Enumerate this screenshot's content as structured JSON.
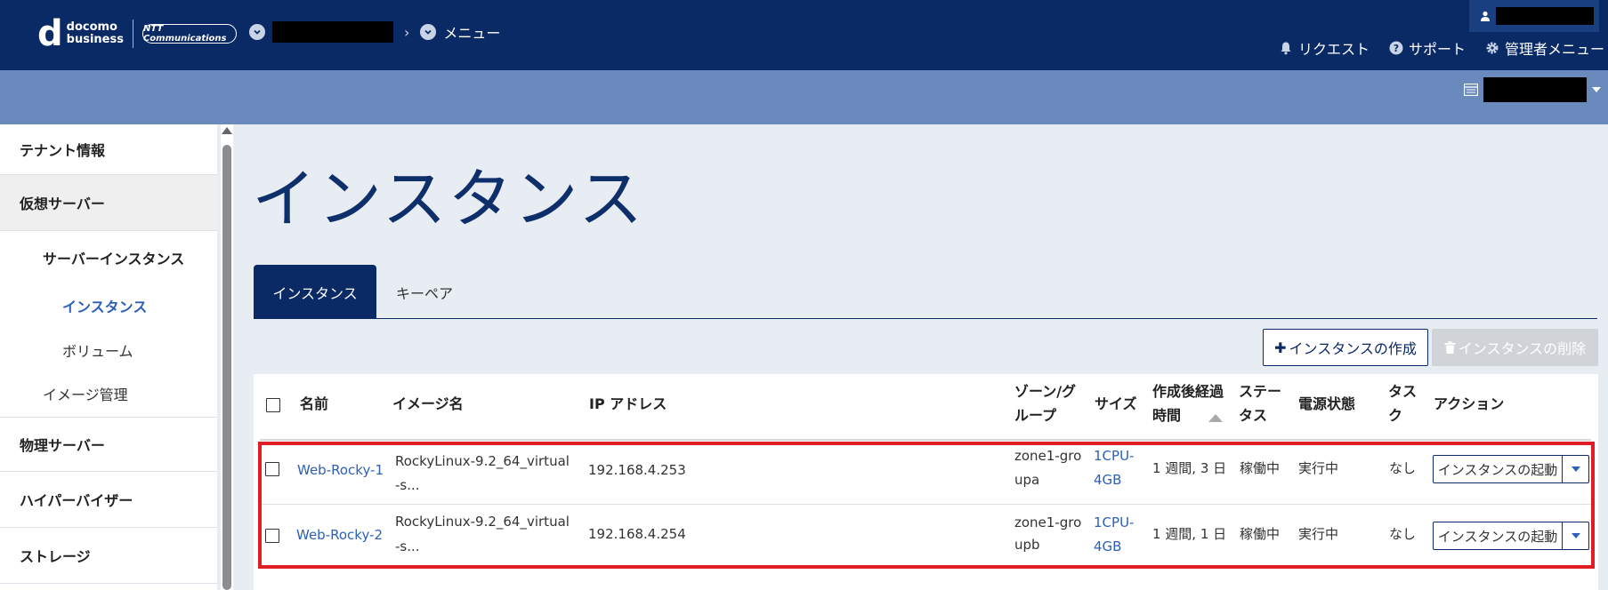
{
  "header": {
    "logo_line1": "docomo",
    "logo_line2": "business",
    "ntt_logo": "NTT Communications",
    "breadcrumb_menu": "メニュー",
    "links": [
      {
        "icon": "bell-icon",
        "label": "リクエスト"
      },
      {
        "icon": "question-icon",
        "label": "サポート"
      },
      {
        "icon": "gear-icon",
        "label": "管理者メニュー"
      }
    ]
  },
  "sidebar": {
    "items": [
      {
        "label": "テナント情報"
      },
      {
        "label": "仮想サーバー"
      },
      {
        "label": "物理サーバー"
      },
      {
        "label": "ハイパーバイザー"
      },
      {
        "label": "ストレージ"
      }
    ],
    "sub": {
      "server_instance": "サーバーインスタンス",
      "instance": "インスタンス",
      "volume": "ボリューム",
      "image_mgmt": "イメージ管理"
    }
  },
  "main": {
    "title": "インスタンス",
    "tabs": [
      {
        "label": "インスタンス"
      },
      {
        "label": "キーペア"
      }
    ],
    "create_button": "インスタンスの作成",
    "delete_button": "インスタンスの削除",
    "columns": {
      "name": "名前",
      "image": "イメージ名",
      "ip": "IP アドレス",
      "zone_1": "ゾーン/グ",
      "zone_2": "ループ",
      "size": "サイズ",
      "age_1": "作成後経過",
      "age_2": "時間",
      "status_1": "ステー",
      "status_2": "タス",
      "power": "電源状態",
      "task_1": "タス",
      "task_2": "ク",
      "action": "アクション"
    },
    "rows": [
      {
        "name": "Web-Rocky-1",
        "image_1": "RockyLinux-9.2_64_virtual",
        "image_2": "-s...",
        "ip": "192.168.4.253",
        "zone_1": "zone1-gro",
        "zone_2": "upa",
        "size_1": "1CPU-",
        "size_2": "4GB",
        "age": "1 週間, 3 日",
        "status": "稼働中",
        "power": "実行中",
        "task": "なし",
        "action": "インスタンスの起動"
      },
      {
        "name": "Web-Rocky-2",
        "image_1": "RockyLinux-9.2_64_virtual",
        "image_2": "-s...",
        "ip": "192.168.4.254",
        "zone_1": "zone1-gro",
        "zone_2": "upb",
        "size_1": "1CPU-",
        "size_2": "4GB",
        "age": "1 週間, 1 日",
        "status": "稼働中",
        "power": "実行中",
        "task": "なし",
        "action": "インスタンスの起動"
      }
    ]
  },
  "colors": {
    "header_bg": "#0a2a66",
    "subbar_bg": "#6a89bd",
    "link": "#2d5fb5",
    "highlight": "#e01c24"
  }
}
